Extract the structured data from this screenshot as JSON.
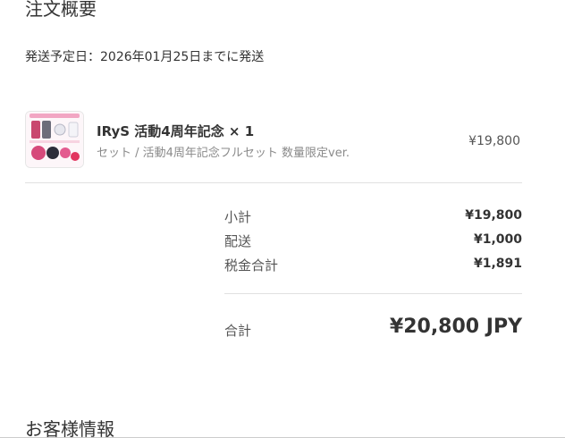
{
  "order_summary": {
    "title": "注文概要",
    "ship_date": "発送予定日：2026年01月25日までに発送"
  },
  "product": {
    "name": "IRyS 活動4周年記念 × 1",
    "variant": "セット / 活動4周年記念フルセット 数量限定ver.",
    "price": "¥19,800",
    "thumbnail_icon": "product-set-thumbnail"
  },
  "summary": {
    "subtotal_label": "小計",
    "subtotal_value": "¥19,800",
    "shipping_label": "配送",
    "shipping_value": "¥1,000",
    "tax_label": "税金合計",
    "tax_value": "¥1,891",
    "total_label": "合計",
    "total_value": "¥20,800 JPY"
  },
  "customer_info": {
    "title": "お客様情報"
  }
}
